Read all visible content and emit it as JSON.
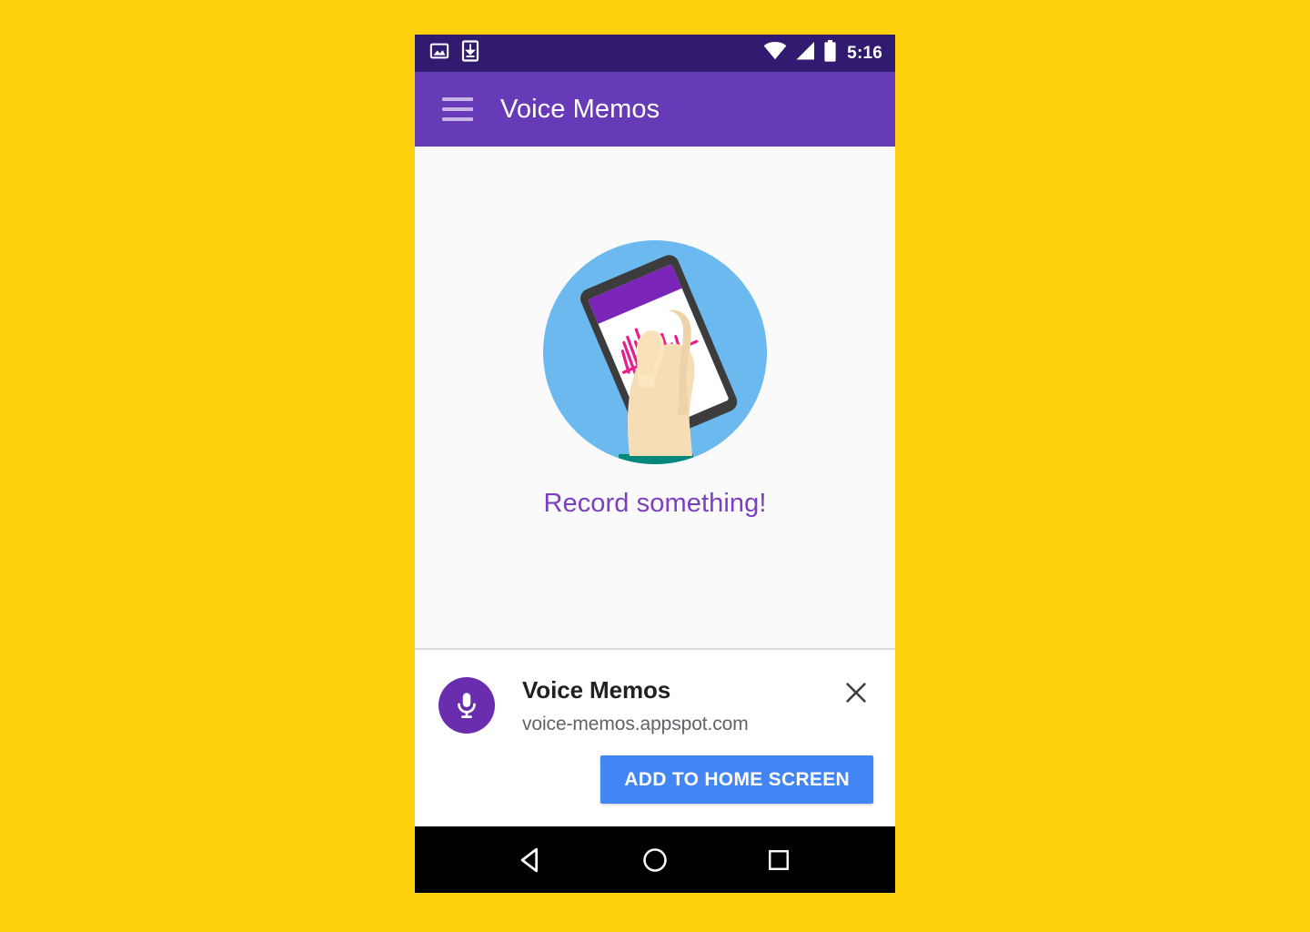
{
  "page": {
    "background_color": "#FFD10D"
  },
  "phone": {
    "status_bar": {
      "background_color": "#311B71",
      "left_icons": [
        {
          "name": "screenshot-image-icon",
          "glyph": "image"
        },
        {
          "name": "download-icon",
          "glyph": "download"
        }
      ],
      "right_icons": [
        {
          "name": "wifi-icon",
          "glyph": "wifi"
        },
        {
          "name": "cellular-signal-icon",
          "glyph": "signal"
        },
        {
          "name": "battery-icon",
          "glyph": "battery"
        }
      ],
      "time": "5:16"
    },
    "app_bar": {
      "background_color": "#673AB7",
      "menu_icon": "hamburger-menu-icon",
      "title": "Voice Memos"
    },
    "main": {
      "background_color": "#FAFAFA",
      "illustration": {
        "name": "hand-holding-phone-illustration",
        "circle_color": "#6BB9EF",
        "phone_body_color": "#3C3C3C",
        "phone_screen_color": "#FFFFFF",
        "phone_app_bar_color": "#7B24B8",
        "waveform_color": "#E91E8C",
        "skin_color": "#F5DEB6",
        "sleeve_color": "#00897B"
      },
      "empty_message": "Record something!",
      "empty_message_color": "#7B3FBF"
    },
    "install_banner": {
      "background_color": "#FFFFFF",
      "app_icon": {
        "name": "microphone-app-icon",
        "background_color": "#6A2DAD",
        "glyph_color": "#FFFFFF"
      },
      "app_name": "Voice Memos",
      "app_url": "voice-memos.appspot.com",
      "close_icon": "close-icon",
      "add_button_label": "ADD TO HOME SCREEN",
      "add_button_color": "#4285F4"
    },
    "nav_bar": {
      "background_color": "#000000",
      "buttons": [
        {
          "name": "nav-back-button",
          "icon": "triangle-back-icon"
        },
        {
          "name": "nav-home-button",
          "icon": "circle-home-icon"
        },
        {
          "name": "nav-recents-button",
          "icon": "square-recents-icon"
        }
      ]
    }
  }
}
